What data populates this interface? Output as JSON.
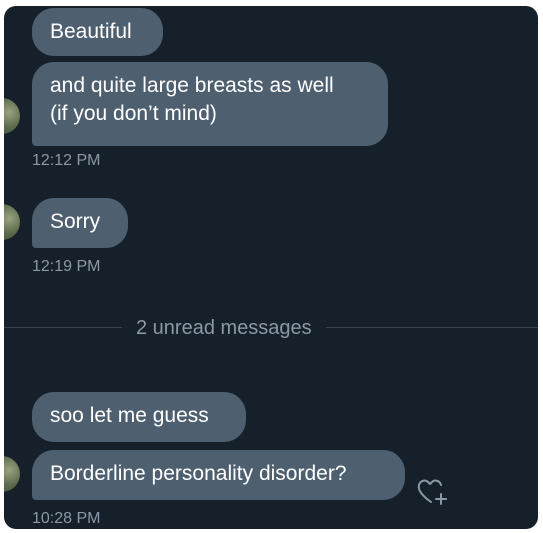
{
  "conversation": {
    "group1": {
      "messages": [
        {
          "text": "Beautiful"
        },
        {
          "line1": "and quite large breasts as well",
          "line2": "(if you don’t mind)"
        }
      ],
      "time": "12:12 PM"
    },
    "group2": {
      "messages": [
        {
          "text": "Sorry"
        }
      ],
      "time": "12:19 PM"
    },
    "unread_divider": "2 unread messages",
    "group3": {
      "messages": [
        {
          "text": "soo let me guess"
        },
        {
          "text": "Borderline personality disorder?"
        }
      ],
      "time": "10:28 PM"
    }
  },
  "icons": {
    "react": "add-reaction-heart-icon",
    "avatar": "avatar-image"
  },
  "colors": {
    "background": "#15202b",
    "bubble": "#4e5f70",
    "timestamp": "#8b98a5",
    "divider": "#38444d"
  }
}
